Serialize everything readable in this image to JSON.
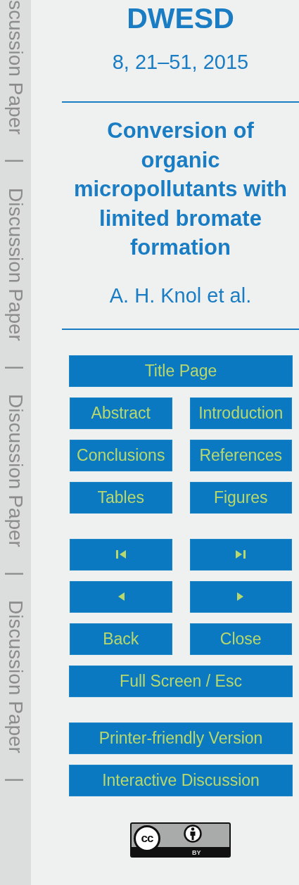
{
  "side_strip": [
    "scussion Paper",
    "|",
    "Discussion Paper",
    "|",
    "Discussion Paper",
    "|",
    "Discussion Paper",
    "|"
  ],
  "journal": "DWESD",
  "citation": "8, 21–51, 2015",
  "title": "Conversion of organic micropollutants with limited bromate formation",
  "authors": "A. H. Knol et al.",
  "nav_groups": [
    [
      [
        {
          "kind": "text",
          "label": "Title Page"
        }
      ],
      [
        {
          "kind": "text",
          "label": "Abstract"
        },
        {
          "kind": "text",
          "label": "Introduction"
        }
      ],
      [
        {
          "kind": "text",
          "label": "Conclusions"
        },
        {
          "kind": "text",
          "label": "References"
        }
      ],
      [
        {
          "kind": "text",
          "label": "Tables"
        },
        {
          "kind": "text",
          "label": "Figures"
        }
      ]
    ],
    [
      [
        {
          "kind": "first"
        },
        {
          "kind": "last"
        }
      ],
      [
        {
          "kind": "prev"
        },
        {
          "kind": "next"
        }
      ],
      [
        {
          "kind": "text",
          "label": "Back"
        },
        {
          "kind": "text",
          "label": "Close"
        }
      ],
      [
        {
          "kind": "text",
          "label": "Full Screen / Esc"
        }
      ]
    ],
    [
      [
        {
          "kind": "text",
          "label": "Printer-friendly Version"
        }
      ],
      [
        {
          "kind": "text",
          "label": "Interactive Discussion"
        }
      ]
    ]
  ],
  "license_badge": {
    "symbol": "cc",
    "label": "BY"
  }
}
